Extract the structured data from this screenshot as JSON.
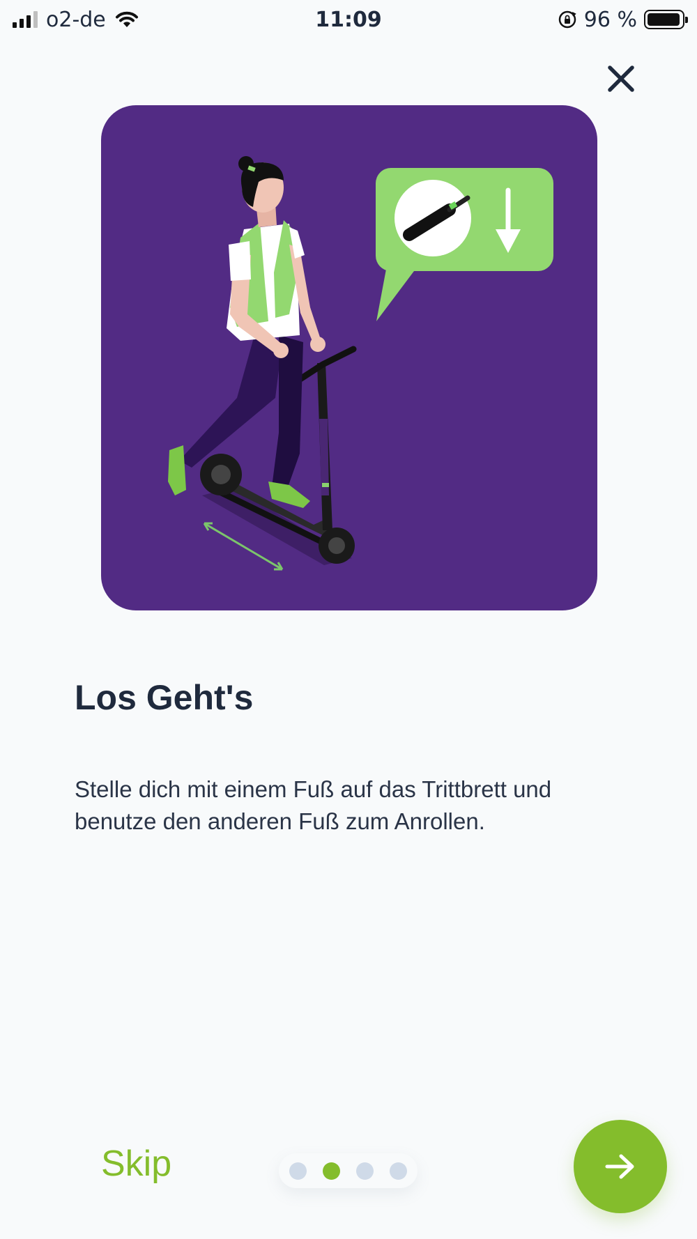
{
  "status_bar": {
    "carrier": "o2-de",
    "time": "11:09",
    "battery_text": "96 %",
    "battery_level": 0.96
  },
  "onboarding": {
    "title": "Los Geht's",
    "description": "Stelle dich mit einem Fuß auf das Trittbrett und benutze den anderen Fuß zum Anrollen.",
    "skip_label": "Skip",
    "pages_total": 4,
    "current_page": 2
  },
  "colors": {
    "accent": "#84bd2c",
    "illustration_bg": "#522b84",
    "bubble": "#93d870",
    "dot_inactive": "#cfdae8",
    "text": "#1f2a3d"
  },
  "icons": {
    "close": "close-icon",
    "next": "arrow-right-icon"
  }
}
